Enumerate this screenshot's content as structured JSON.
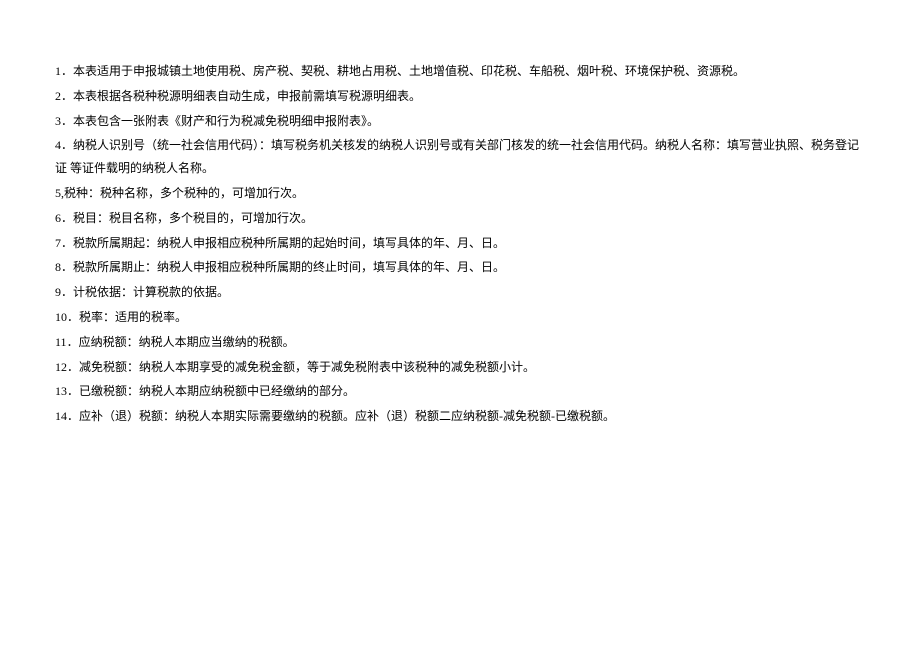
{
  "items": [
    {
      "num": "1",
      "text": "．本表适用于申报城镇土地使用税、房产税、契税、耕地占用税、土地增值税、印花税、车船税、烟叶税、环境保护税、资源税。"
    },
    {
      "num": "2",
      "text": "．本表根据各税种税源明细表自动生成，申报前需填写税源明细表。"
    },
    {
      "num": "3",
      "text": "．本表包含一张附表《财产和行为税减免税明细申报附表》。"
    },
    {
      "num": "4",
      "text": "．纳税人识别号（统一社会信用代码）：填写税务机关核发的纳税人识别号或有关部门核发的统一社会信用代码。纳税人名称：填写营业执照、税务登记证 等证件载明的纳税人名称。"
    },
    {
      "num": "5,",
      "text": "税种：税种名称，多个税种的，可增加行次。"
    },
    {
      "num": "6",
      "text": "．税目：税目名称，多个税目的，可增加行次。"
    },
    {
      "num": "7",
      "text": "．税款所属期起：纳税人申报相应税种所属期的起始时间，填写具体的年、月、日。"
    },
    {
      "num": "8",
      "text": "．税款所属期止：纳税人申报相应税种所属期的终止时间，填写具体的年、月、日。"
    },
    {
      "num": "9",
      "text": "．计税依据：计算税款的依据。"
    },
    {
      "num": "10",
      "text": "．税率：适用的税率。"
    },
    {
      "num": "11",
      "text": "．应纳税额：纳税人本期应当缴纳的税额。"
    },
    {
      "num": "12",
      "text": "．减免税额：纳税人本期享受的减免税金额，等于减免税附表中该税种的减免税额小计。"
    },
    {
      "num": "13",
      "text": "．已缴税额：纳税人本期应纳税额中已经缴纳的部分。"
    },
    {
      "num": "14",
      "text": "．应补（退）税额：纳税人本期实际需要缴纳的税额。应补（退）税额二应纳税额-减免税额-已缴税额。"
    }
  ]
}
